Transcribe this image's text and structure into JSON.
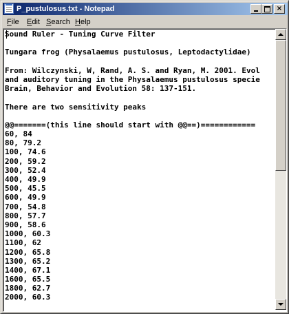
{
  "window": {
    "title": "P_pustulosus.txt - Notepad",
    "controls": {
      "minimize": "_",
      "maximize": "□",
      "close": "×"
    }
  },
  "menu": {
    "items": [
      {
        "first": "F",
        "rest": "ile"
      },
      {
        "first": "E",
        "rest": "dit"
      },
      {
        "first": "S",
        "rest": "earch"
      },
      {
        "first": "H",
        "rest": "elp"
      }
    ]
  },
  "document": {
    "lines": [
      "Sound Ruler - Tuning Curve Filter",
      "",
      "Tungara frog (Physalaemus pustulosus, Leptodactylidae)",
      "",
      "From: Wilczynski, W, Rand, A. S. and Ryan, M. 2001. Evol",
      "and auditory tuning in the Physalaemus pustulosus specie",
      "Brain, Behavior and Evolution 58: 137-151.",
      "",
      "There are two sensitivity peaks",
      "",
      "@@=======(this line should start with @@==)============",
      "60, 84",
      "80, 79.2",
      "100, 74.6",
      "200, 59.2",
      "300, 52.4",
      "400, 49.9",
      "500, 45.5",
      "600, 49.9",
      "700, 54.8",
      "800, 57.7",
      "900, 58.6",
      "1000, 60.3",
      "1100, 62",
      "1200, 65.8",
      "1300, 65.2",
      "1400, 67.1",
      "1600, 65.5",
      "1800, 62.7",
      "2000, 60.3"
    ]
  }
}
